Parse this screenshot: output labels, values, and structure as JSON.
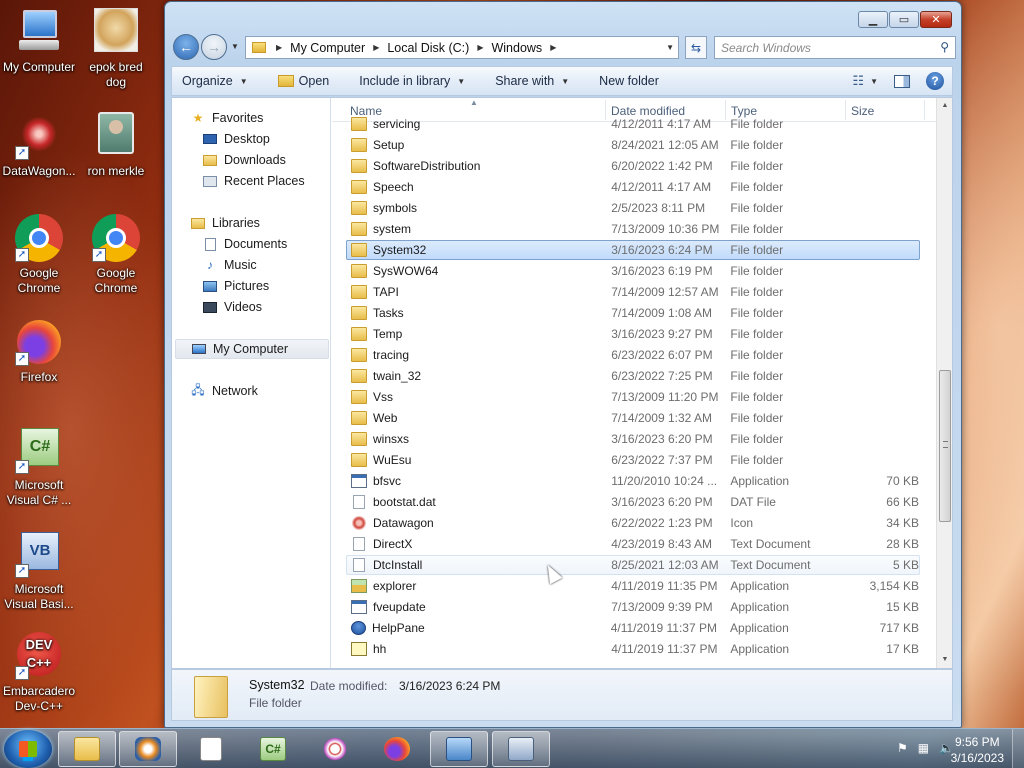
{
  "desktop": {
    "icons": [
      {
        "label": "My Computer",
        "icon": "computer-icon"
      },
      {
        "label": "epok bred dog",
        "icon": "dog-image-icon"
      },
      {
        "label": "DataWagon...",
        "icon": "datawagon-icon"
      },
      {
        "label": "ron merkle",
        "icon": "user-folder-icon"
      },
      {
        "label": "Google Chrome",
        "icon": "chrome-icon"
      },
      {
        "label": "Google Chrome",
        "icon": "chrome-icon"
      },
      {
        "label": "Firefox",
        "icon": "firefox-icon"
      },
      {
        "label": "Microsoft Visual C# ...",
        "icon": "visual-csharp-icon"
      },
      {
        "label": "Microsoft Visual Basi...",
        "icon": "visual-basic-icon"
      },
      {
        "label": "Embarcadero Dev-C++",
        "icon": "devcpp-icon"
      }
    ]
  },
  "window": {
    "address": [
      "My Computer",
      "Local Disk (C:)",
      "Windows"
    ],
    "search_placeholder": "Search Windows",
    "toolbar": {
      "organize": "Organize",
      "open": "Open",
      "include": "Include in library",
      "share": "Share with",
      "new_folder": "New folder"
    },
    "nav": {
      "favorites": "Favorites",
      "desktop": "Desktop",
      "downloads": "Downloads",
      "recent": "Recent Places",
      "libraries": "Libraries",
      "documents": "Documents",
      "music": "Music",
      "pictures": "Pictures",
      "videos": "Videos",
      "computer": "My Computer",
      "network": "Network"
    },
    "columns": {
      "name": "Name",
      "date": "Date modified",
      "type": "Type",
      "size": "Size"
    },
    "files": [
      {
        "name": "servicing",
        "date": "4/12/2011 4:17 AM",
        "type": "File folder",
        "size": "",
        "icon": "folder"
      },
      {
        "name": "Setup",
        "date": "8/24/2021 12:05 AM",
        "type": "File folder",
        "size": "",
        "icon": "folder"
      },
      {
        "name": "SoftwareDistribution",
        "date": "6/20/2022 1:42 PM",
        "type": "File folder",
        "size": "",
        "icon": "folder"
      },
      {
        "name": "Speech",
        "date": "4/12/2011 4:17 AM",
        "type": "File folder",
        "size": "",
        "icon": "folder"
      },
      {
        "name": "symbols",
        "date": "2/5/2023 8:11 PM",
        "type": "File folder",
        "size": "",
        "icon": "folder"
      },
      {
        "name": "system",
        "date": "7/13/2009 10:36 PM",
        "type": "File folder",
        "size": "",
        "icon": "folder"
      },
      {
        "name": "System32",
        "date": "3/16/2023 6:24 PM",
        "type": "File folder",
        "size": "",
        "icon": "folder",
        "selected": true
      },
      {
        "name": "SysWOW64",
        "date": "3/16/2023 6:19 PM",
        "type": "File folder",
        "size": "",
        "icon": "folder"
      },
      {
        "name": "TAPI",
        "date": "7/14/2009 12:57 AM",
        "type": "File folder",
        "size": "",
        "icon": "folder"
      },
      {
        "name": "Tasks",
        "date": "7/14/2009 1:08 AM",
        "type": "File folder",
        "size": "",
        "icon": "folder"
      },
      {
        "name": "Temp",
        "date": "3/16/2023 9:27 PM",
        "type": "File folder",
        "size": "",
        "icon": "folder"
      },
      {
        "name": "tracing",
        "date": "6/23/2022 6:07 PM",
        "type": "File folder",
        "size": "",
        "icon": "folder"
      },
      {
        "name": "twain_32",
        "date": "6/23/2022 7:25 PM",
        "type": "File folder",
        "size": "",
        "icon": "folder"
      },
      {
        "name": "Vss",
        "date": "7/13/2009 11:20 PM",
        "type": "File folder",
        "size": "",
        "icon": "folder"
      },
      {
        "name": "Web",
        "date": "7/14/2009 1:32 AM",
        "type": "File folder",
        "size": "",
        "icon": "folder"
      },
      {
        "name": "winsxs",
        "date": "3/16/2023 6:20 PM",
        "type": "File folder",
        "size": "",
        "icon": "folder"
      },
      {
        "name": "WuEsu",
        "date": "6/23/2022 7:37 PM",
        "type": "File folder",
        "size": "",
        "icon": "folder"
      },
      {
        "name": "bfsvc",
        "date": "11/20/2010 10:24 ...",
        "type": "Application",
        "size": "70 KB",
        "icon": "app"
      },
      {
        "name": "bootstat.dat",
        "date": "3/16/2023 6:20 PM",
        "type": "DAT File",
        "size": "66 KB",
        "icon": "dat"
      },
      {
        "name": "Datawagon",
        "date": "6/22/2022 1:23 PM",
        "type": "Icon",
        "size": "34 KB",
        "icon": "flower"
      },
      {
        "name": "DirectX",
        "date": "4/23/2019 8:43 AM",
        "type": "Text Document",
        "size": "28 KB",
        "icon": "doc"
      },
      {
        "name": "DtcInstall",
        "date": "8/25/2021 12:03 AM",
        "type": "Text Document",
        "size": "5 KB",
        "icon": "doc",
        "hover": true
      },
      {
        "name": "explorer",
        "date": "4/11/2019 11:35 PM",
        "type": "Application",
        "size": "3,154 KB",
        "icon": "explorer"
      },
      {
        "name": "fveupdate",
        "date": "7/13/2009 9:39 PM",
        "type": "Application",
        "size": "15 KB",
        "icon": "app"
      },
      {
        "name": "HelpPane",
        "date": "4/11/2019 11:37 PM",
        "type": "Application",
        "size": "717 KB",
        "icon": "help"
      },
      {
        "name": "hh",
        "date": "4/11/2019 11:37 PM",
        "type": "Application",
        "size": "17 KB",
        "icon": "hh"
      }
    ],
    "details": {
      "name": "System32",
      "date_label": "Date modified:",
      "date_value": "3/16/2023 6:24 PM",
      "type": "File folder"
    }
  },
  "taskbar": {
    "items": [
      "explorer-icon",
      "media-player-icon",
      "notepad-icon",
      "visual-csharp-icon",
      "snipping-tool-icon",
      "firefox-icon",
      "remote-desktop-icon",
      "keyboard-icon"
    ],
    "time": "9:56 PM",
    "date": "3/16/2023"
  }
}
